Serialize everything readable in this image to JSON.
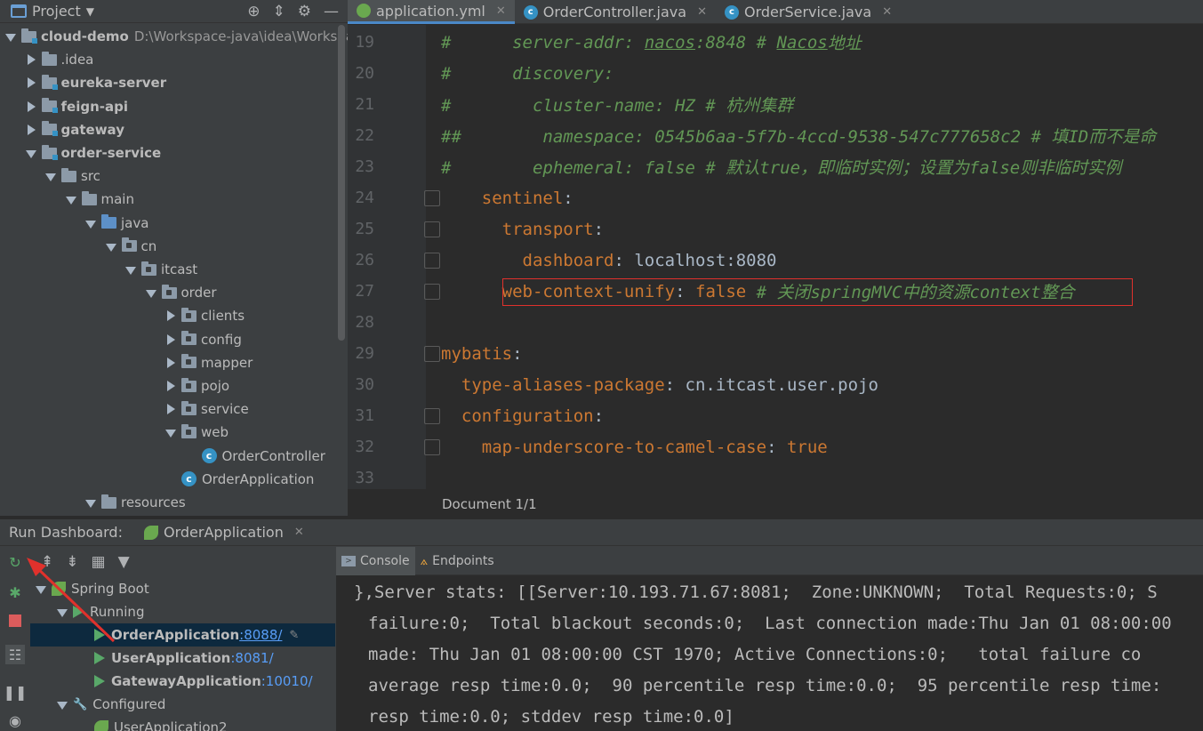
{
  "project": {
    "title": "Project",
    "tree": [
      {
        "label": "cloud-demo",
        "path": "D:\\Workspace-java\\idea\\Workspa",
        "arrow": "down",
        "icon": "module",
        "bold": true,
        "indent": 0
      },
      {
        "label": ".idea",
        "arrow": "right",
        "icon": "folder",
        "bold": false,
        "indent": 1
      },
      {
        "label": "eureka-server",
        "arrow": "right",
        "icon": "module",
        "bold": true,
        "indent": 1
      },
      {
        "label": "feign-api",
        "arrow": "right",
        "icon": "module",
        "bold": true,
        "indent": 1
      },
      {
        "label": "gateway",
        "arrow": "right",
        "icon": "module",
        "bold": true,
        "indent": 1
      },
      {
        "label": "order-service",
        "arrow": "down",
        "icon": "module",
        "bold": true,
        "indent": 1
      },
      {
        "label": "src",
        "arrow": "down",
        "icon": "folder",
        "bold": false,
        "indent": 2
      },
      {
        "label": "main",
        "arrow": "down",
        "icon": "folder",
        "bold": false,
        "indent": 3
      },
      {
        "label": "java",
        "arrow": "down",
        "icon": "src",
        "bold": false,
        "indent": 4
      },
      {
        "label": "cn",
        "arrow": "down",
        "icon": "pkg",
        "bold": false,
        "indent": 5
      },
      {
        "label": "itcast",
        "arrow": "down",
        "icon": "pkg",
        "bold": false,
        "indent": 6
      },
      {
        "label": "order",
        "arrow": "down",
        "icon": "pkg",
        "bold": false,
        "indent": 7
      },
      {
        "label": "clients",
        "arrow": "right",
        "icon": "pkg",
        "bold": false,
        "indent": 8
      },
      {
        "label": "config",
        "arrow": "right",
        "icon": "pkg",
        "bold": false,
        "indent": 8
      },
      {
        "label": "mapper",
        "arrow": "right",
        "icon": "pkg",
        "bold": false,
        "indent": 8
      },
      {
        "label": "pojo",
        "arrow": "right",
        "icon": "pkg",
        "bold": false,
        "indent": 8
      },
      {
        "label": "service",
        "arrow": "right",
        "icon": "pkg",
        "bold": false,
        "indent": 8
      },
      {
        "label": "web",
        "arrow": "down",
        "icon": "pkg",
        "bold": false,
        "indent": 8
      },
      {
        "label": "OrderController",
        "arrow": "none",
        "icon": "class",
        "bold": false,
        "indent": 9
      },
      {
        "label": "OrderApplication",
        "arrow": "none",
        "icon": "class",
        "bold": false,
        "indent": 8
      },
      {
        "label": "resources",
        "arrow": "down",
        "icon": "res",
        "bold": false,
        "indent": 4
      }
    ]
  },
  "editor": {
    "tabs": [
      {
        "label": "application.yml",
        "icon": "yml",
        "active": true
      },
      {
        "label": "OrderController.java",
        "icon": "c",
        "active": false
      },
      {
        "label": "OrderService.java",
        "icon": "c",
        "active": false
      }
    ],
    "lines": [
      {
        "num": "19",
        "parts": [
          [
            "cm",
            "#      server-addr: "
          ],
          [
            "cmk",
            "nacos"
          ],
          [
            "cm",
            ":8848 # "
          ],
          [
            "cmk",
            "Nacos"
          ],
          [
            "cm",
            "地址"
          ]
        ]
      },
      {
        "num": "20",
        "parts": [
          [
            "cm",
            "#      discovery:"
          ]
        ]
      },
      {
        "num": "21",
        "parts": [
          [
            "cm",
            "#        cluster-name: HZ # 杭州集群"
          ]
        ]
      },
      {
        "num": "22",
        "parts": [
          [
            "cm",
            "##        namespace: 0545b6aa-5f7b-4ccd-9538-547c777658c2 # 填ID而不是命"
          ]
        ]
      },
      {
        "num": "23",
        "parts": [
          [
            "cm",
            "#        ephemeral: false # 默认true，即临时实例；设置为false则非临时实例"
          ]
        ]
      },
      {
        "num": "24",
        "parts": [
          [
            "v",
            "    "
          ],
          [
            "k",
            "sentinel"
          ],
          [
            "v",
            ":"
          ]
        ]
      },
      {
        "num": "25",
        "parts": [
          [
            "v",
            "      "
          ],
          [
            "k",
            "transport"
          ],
          [
            "v",
            ":"
          ]
        ]
      },
      {
        "num": "26",
        "parts": [
          [
            "v",
            "        "
          ],
          [
            "k",
            "dashboard"
          ],
          [
            "v",
            ": localhost:8080"
          ]
        ]
      },
      {
        "num": "27",
        "parts": [
          [
            "v",
            "      "
          ],
          [
            "k",
            "web-context-unify"
          ],
          [
            "v",
            ": "
          ],
          [
            "bool",
            "false"
          ],
          [
            "cm",
            " # 关闭springMVC中的资源context整合"
          ]
        ]
      },
      {
        "num": "28",
        "parts": []
      },
      {
        "num": "29",
        "parts": [
          [
            "k",
            "mybatis"
          ],
          [
            "v",
            ":"
          ]
        ]
      },
      {
        "num": "30",
        "parts": [
          [
            "v",
            "  "
          ],
          [
            "k",
            "type-aliases-package"
          ],
          [
            "v",
            ": cn.itcast.user.pojo"
          ]
        ]
      },
      {
        "num": "31",
        "parts": [
          [
            "v",
            "  "
          ],
          [
            "k",
            "configuration"
          ],
          [
            "v",
            ":"
          ]
        ]
      },
      {
        "num": "32",
        "parts": [
          [
            "v",
            "    "
          ],
          [
            "k",
            "map-underscore-to-camel-case"
          ],
          [
            "v",
            ": "
          ],
          [
            "bool",
            "true"
          ]
        ]
      },
      {
        "num": "33",
        "parts": []
      }
    ],
    "status": "Document 1/1"
  },
  "run_dashboard": {
    "label": "Run Dashboard:",
    "tab": "OrderApplication",
    "tree": [
      {
        "label": "Spring Boot",
        "type": "group",
        "indent": 0
      },
      {
        "label": "Running",
        "type": "status",
        "indent": 1
      },
      {
        "label": "OrderApplication",
        "port": ":8088/",
        "type": "app",
        "indent": 2,
        "selected": true
      },
      {
        "label": "UserApplication",
        "port": ":8081/",
        "type": "app",
        "indent": 2,
        "selected": false
      },
      {
        "label": "GatewayApplication",
        "port": ":10010/",
        "type": "app",
        "indent": 2,
        "selected": false
      },
      {
        "label": "Configured",
        "type": "configured",
        "indent": 1
      },
      {
        "label": "UserApplication2",
        "type": "cfgapp",
        "indent": 2
      }
    ],
    "console_tabs": [
      {
        "label": "Console",
        "active": true
      },
      {
        "label": "Endpoints",
        "active": false
      }
    ],
    "console_lines": [
      "},Server stats: [[Server:10.193.71.67:8081;\tZone:UNKNOWN;\tTotal Requests:0;\tS",
      "failure:0;\tTotal blackout seconds:0;\tLast connection made:Thu Jan 01 08:00:00",
      "made: Thu Jan 01 08:00:00 CST 1970;\tActive Connections:0;\ttotal failure co",
      "average resp time:0.0;\t90 percentile resp time:0.0;\t95 percentile resp time:",
      "resp time:0.0;\tstddev resp time:0.0]"
    ]
  },
  "colors": {
    "accent": "#4a88c7",
    "highlight_border": "#e0312c",
    "run_green": "#59a869",
    "port_link": "#589df6"
  }
}
